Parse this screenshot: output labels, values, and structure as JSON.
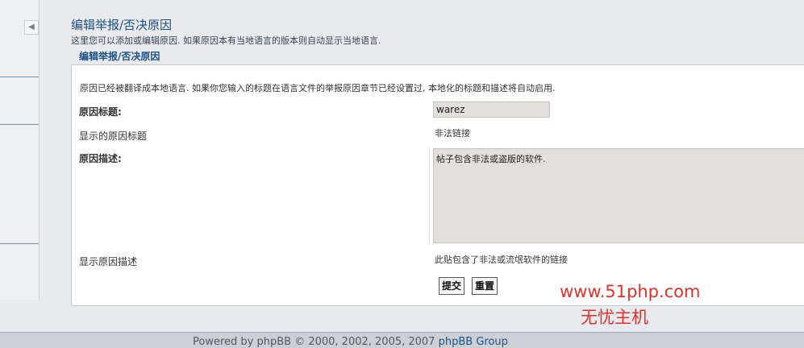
{
  "header": {
    "title": "编辑举报/否决原因",
    "description": "这里您可以添加或编辑原因. 如果原因本有当地语言的版本则自动显示当地语言."
  },
  "section": {
    "title": "编辑举报/否决原因",
    "info": "原因已经被翻译成本地语言. 如果你您输入的标题在语言文件的举报原因章节已经设置过, 本地化的标题和描述将自动启用."
  },
  "form": {
    "reason_title_label": "原因标题:",
    "reason_title_value": "warez",
    "displayed_title_label": "显示的原因标题",
    "displayed_title_value": "非法链接",
    "reason_desc_label": "原因描述:",
    "reason_desc_value": "帖子包含非法或盗版的软件.",
    "displayed_desc_label": "显示原因描述",
    "displayed_desc_value": "此贴包含了非法或流氓软件的链接",
    "submit_label": "提交",
    "reset_label": "重置"
  },
  "watermark": {
    "url": "www.51php.com",
    "text": "无忧主机"
  },
  "footer": {
    "prefix": "Powered by phpBB © 2000, 2002, 2005, 2007",
    "brand": "phpBB Group"
  },
  "icons": {
    "collapse": "collapse-arrow-left-icon"
  },
  "colors": {
    "title": "#1b4f8a",
    "watermark": "#e0322d",
    "input_bg": "#e3e0d9"
  }
}
